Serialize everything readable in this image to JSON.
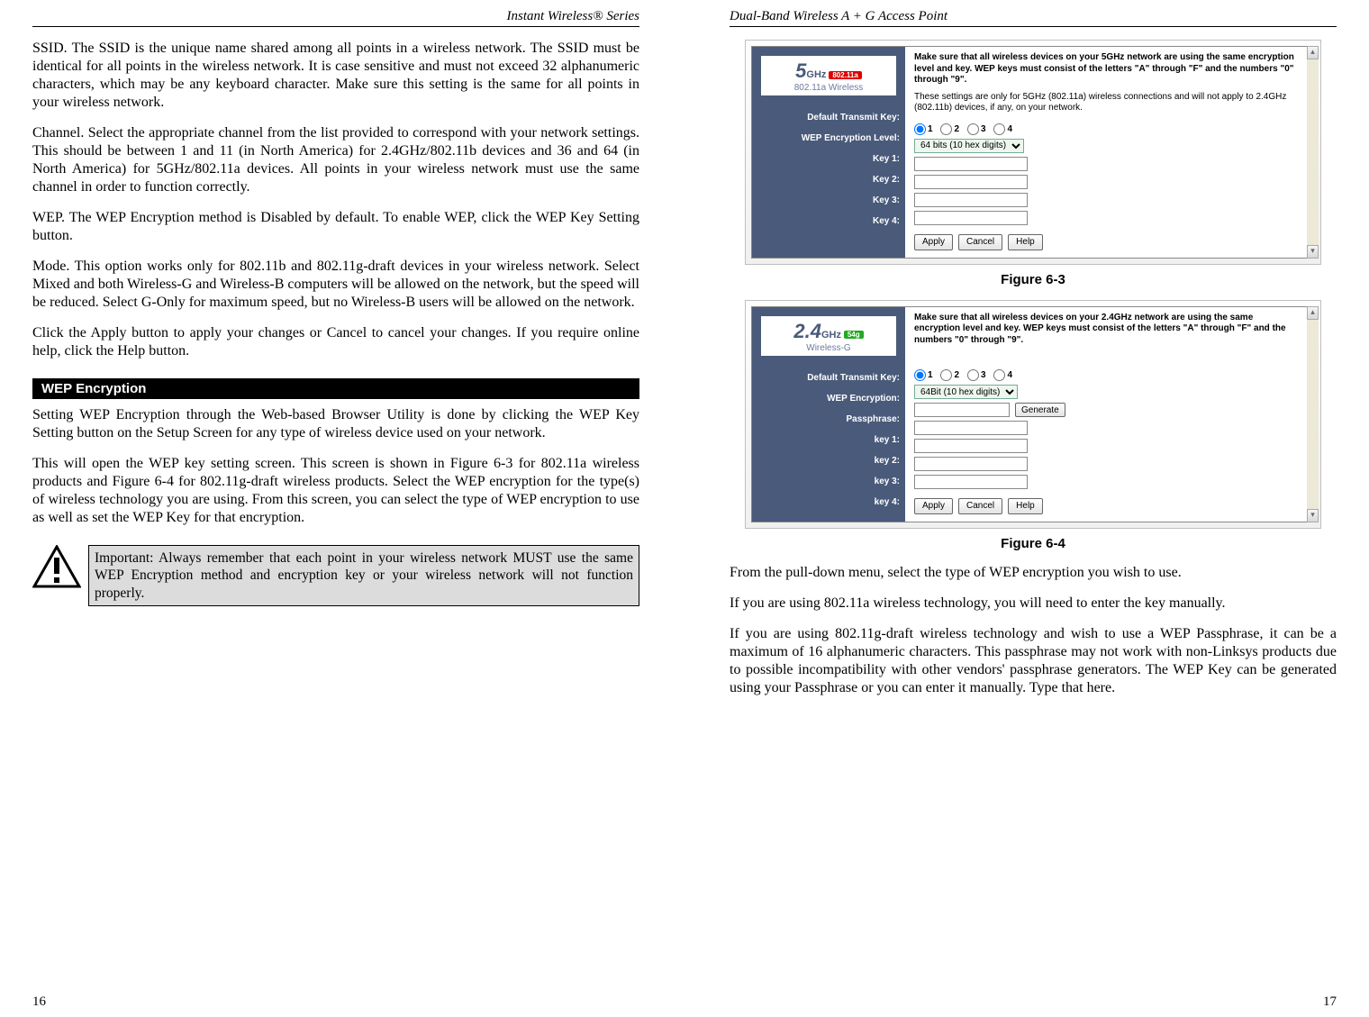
{
  "left": {
    "running_head": "Instant Wireless® Series",
    "p_ssid": "SSID. The SSID is the unique name shared among all points in a wireless network. The SSID must be identical for all points in the wireless network. It is case sensitive and must not exceed 32 alphanumeric characters, which may be any keyboard character. Make sure this setting is the same for all points in your wireless network.",
    "p_channel": "Channel. Select the appropriate channel from the list provided to correspond with your network settings. This should be between 1 and 11 (in North America) for 2.4GHz/802.11b devices and 36 and 64 (in North America) for 5GHz/802.11a devices. All points in your wireless network must use the same channel in order to function correctly.",
    "p_wep": "WEP. The WEP Encryption method is Disabled by default. To enable WEP, click the WEP Key Setting button.",
    "p_mode": "Mode.  This option works only for 802.11b and 802.11g-draft devices in your wireless network. Select Mixed and both Wireless-G and Wireless-B computers will be allowed on the network, but the speed will be reduced. Select G-Only for maximum speed, but no Wireless-B users will be allowed on the network.",
    "p_apply": "Click the Apply button to apply your changes or Cancel to cancel your changes. If you require online help, click the Help button.",
    "section_bar": "WEP Encryption",
    "p_wep2": "Setting WEP Encryption through the Web-based Browser Utility is done by clicking the WEP Key Setting button on the Setup Screen for any type of wireless device used on your network.",
    "p_wep3": "This will open the WEP key setting screen. This screen is shown in Figure 6-3 for 802.11a wireless products and Figure 6-4 for 802.11g-draft wireless products. Select the WEP encryption for the type(s) of wireless technology you are using. From this screen, you can select the type of WEP encryption to use as well as set the WEP Key for that encryption.",
    "important": "Important: Always remember that each point in your wireless network MUST use the same WEP Encryption method and encryption key or your wireless network will not function properly.",
    "page_number": "16"
  },
  "right": {
    "running_head": "Dual-Band Wireless A + G Access Point",
    "fig63_caption": "Figure 6-3",
    "fig64_caption": "Figure 6-4",
    "fig63": {
      "band_num": "5",
      "band_unit": "GHz",
      "band_chip": "802.11a",
      "band_sub": "802.11a Wireless",
      "notice": "Make sure that all wireless devices on your 5GHz network are using the same encryption level and key. WEP keys must consist of the letters \"A\" through \"F\" and the numbers \"0\" through \"9\".",
      "notice2": "These settings are only for 5GHz (802.11a) wireless connections and will not apply to 2.4GHz (802.11b) devices, if any, on your network.",
      "label_txkey": "Default Transmit Key:",
      "label_enc": "WEP Encryption Level:",
      "label_k1": "Key 1:",
      "label_k2": "Key 2:",
      "label_k3": "Key 3:",
      "label_k4": "Key 4:",
      "radio1": "1",
      "radio2": "2",
      "radio3": "3",
      "radio4": "4",
      "enc_value": "64 bits (10 hex digits)",
      "btn_apply": "Apply",
      "btn_cancel": "Cancel",
      "btn_help": "Help"
    },
    "fig64": {
      "band_num": "2.4",
      "band_unit": "GHz",
      "band_chip": "54g",
      "band_sub": "Wireless-G",
      "notice": "Make sure that all wireless devices on your 2.4GHz network are using the same encryption level and key. WEP keys must consist of the letters \"A\" through \"F\" and the numbers \"0\" through \"9\".",
      "label_txkey": "Default Transmit Key:",
      "label_enc": "WEP Encryption:",
      "label_pass": "Passphrase:",
      "label_k1": "key 1:",
      "label_k2": "key 2:",
      "label_k3": "key 3:",
      "label_k4": "key 4:",
      "radio1": "1",
      "radio2": "2",
      "radio3": "3",
      "radio4": "4",
      "enc_value": "64Bit (10 hex digits)",
      "btn_generate": "Generate",
      "btn_apply": "Apply",
      "btn_cancel": "Cancel",
      "btn_help": "Help"
    },
    "p1": "From the pull-down menu, select the type of WEP encryption you wish to use.",
    "p2": "If you are using 802.11a wireless technology, you will need to enter the key manually.",
    "p3": "If you are using 802.11g-draft wireless technology and wish to use a WEP Passphrase, it can be a maximum of 16 alphanumeric characters. This passphrase may not work with non-Linksys products due to possible incompatibility with other vendors' passphrase generators.  The WEP Key can be generated using your Passphrase  or you can enter it manually.  Type that here.",
    "page_number": "17"
  }
}
